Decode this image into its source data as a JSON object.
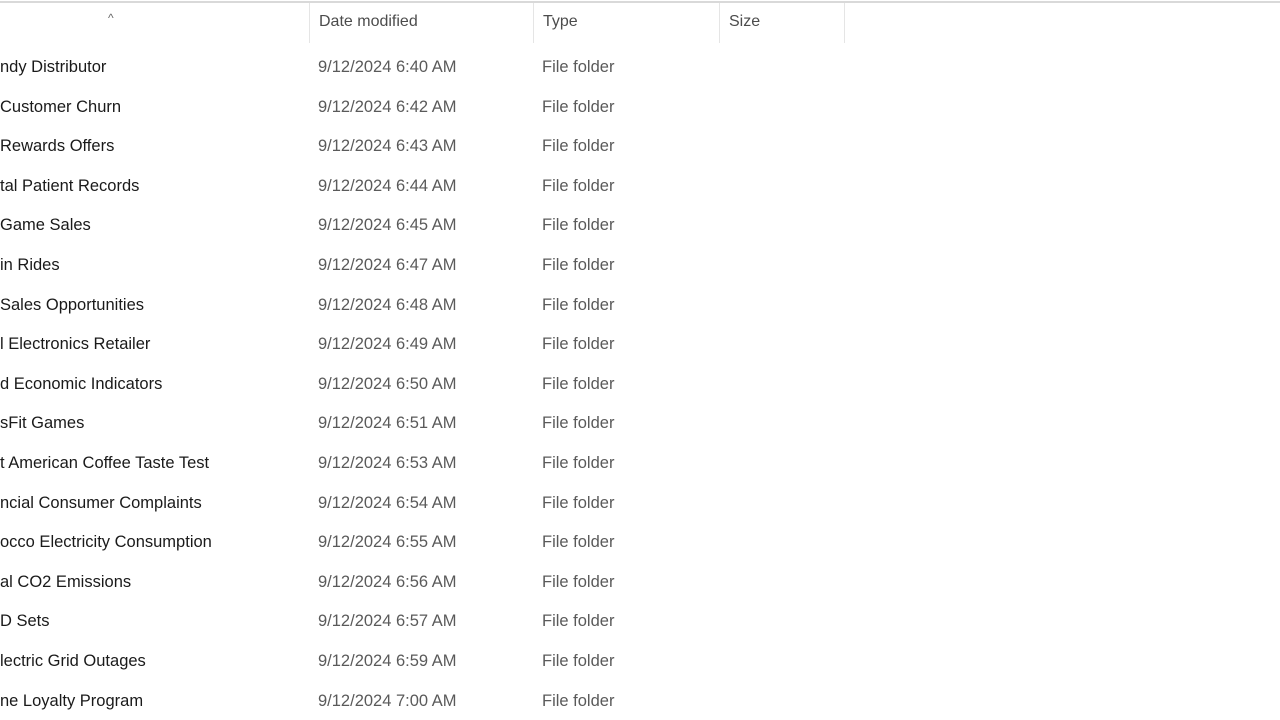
{
  "header": {
    "sort_indicator": "^",
    "columns": [
      "Date modified",
      "Type",
      "Size"
    ]
  },
  "rows": [
    {
      "name": "ndy Distributor",
      "date": "9/12/2024 6:40 AM",
      "type": "File folder"
    },
    {
      "name": "Customer Churn",
      "date": "9/12/2024 6:42 AM",
      "type": "File folder"
    },
    {
      "name": "Rewards Offers",
      "date": "9/12/2024 6:43 AM",
      "type": "File folder"
    },
    {
      "name": "tal Patient Records",
      "date": "9/12/2024 6:44 AM",
      "type": "File folder"
    },
    {
      "name": " Game Sales",
      "date": "9/12/2024 6:45 AM",
      "type": "File folder"
    },
    {
      "name": "in Rides",
      "date": "9/12/2024 6:47 AM",
      "type": "File folder"
    },
    {
      "name": "Sales Opportunities",
      "date": "9/12/2024 6:48 AM",
      "type": "File folder"
    },
    {
      "name": "l Electronics Retailer",
      "date": "9/12/2024 6:49 AM",
      "type": "File folder"
    },
    {
      "name": "d Economic Indicators",
      "date": "9/12/2024 6:50 AM",
      "type": "File folder"
    },
    {
      "name": "sFit Games",
      "date": "9/12/2024 6:51 AM",
      "type": "File folder"
    },
    {
      "name": "t American Coffee Taste Test",
      "date": "9/12/2024 6:53 AM",
      "type": "File folder"
    },
    {
      "name": "ncial Consumer Complaints",
      "date": "9/12/2024 6:54 AM",
      "type": "File folder"
    },
    {
      "name": "occo Electricity Consumption",
      "date": "9/12/2024 6:55 AM",
      "type": "File folder"
    },
    {
      "name": "al CO2 Emissions",
      "date": "9/12/2024 6:56 AM",
      "type": "File folder"
    },
    {
      "name": "D Sets",
      "date": "9/12/2024 6:57 AM",
      "type": "File folder"
    },
    {
      "name": "lectric Grid Outages",
      "date": "9/12/2024 6:59 AM",
      "type": "File folder"
    },
    {
      "name": "ne Loyalty Program",
      "date": "9/12/2024 7:00 AM",
      "type": "File folder"
    }
  ]
}
